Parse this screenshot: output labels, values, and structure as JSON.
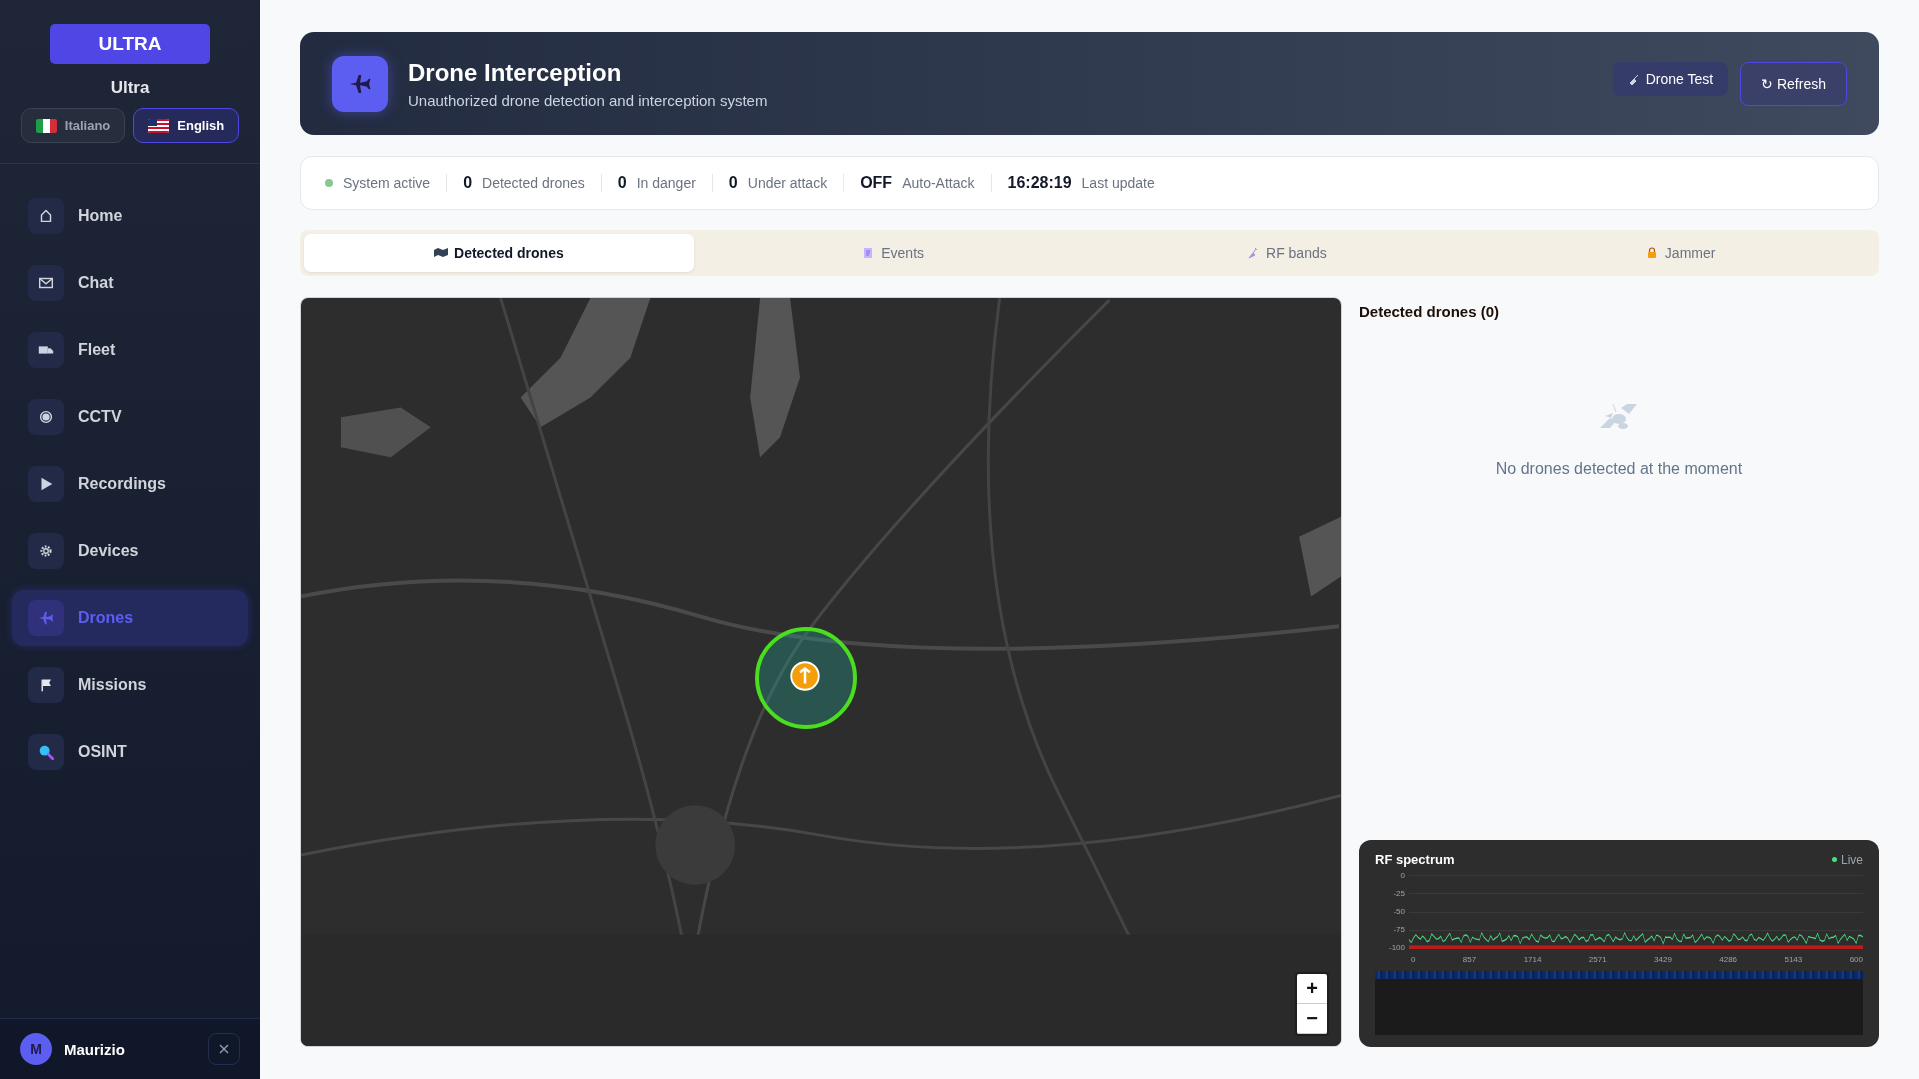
{
  "sidebar": {
    "logo": "ULTRA",
    "brand": "Ultra",
    "languages": [
      {
        "label": "Italiano",
        "selected": false
      },
      {
        "label": "English",
        "selected": true
      }
    ],
    "items": [
      {
        "label": "Home",
        "selected": false
      },
      {
        "label": "Chat",
        "selected": false
      },
      {
        "label": "Fleet",
        "selected": false
      },
      {
        "label": "CCTV",
        "selected": false
      },
      {
        "label": "Recordings",
        "selected": false
      },
      {
        "label": "Devices",
        "selected": false
      },
      {
        "label": "Drones",
        "selected": true
      },
      {
        "label": "Missions",
        "selected": false
      },
      {
        "label": "OSINT",
        "selected": false
      }
    ],
    "user": {
      "initial": "M",
      "name": "Maurizio"
    }
  },
  "header": {
    "title": "Drone Interception",
    "subtitle": "Unauthorized drone detection and interception system",
    "buttons": [
      {
        "label": "Drone Test",
        "kind": "test"
      },
      {
        "label": "↻ Refresh",
        "kind": "refresh"
      }
    ]
  },
  "status": [
    {
      "kind": "indicator",
      "label": "System active",
      "on": true
    },
    {
      "kind": "count",
      "value": "0",
      "label": "Detected drones"
    },
    {
      "kind": "count",
      "value": "0",
      "label": "In danger"
    },
    {
      "kind": "count",
      "value": "0",
      "label": "Under attack"
    },
    {
      "kind": "count",
      "value": "OFF",
      "label": "Auto-Attack"
    },
    {
      "kind": "count",
      "value": "16:28:19",
      "label": "Last update"
    }
  ],
  "tabs": [
    {
      "label": "Detected drones",
      "selected": true
    },
    {
      "label": "Events",
      "selected": false
    },
    {
      "label": "RF bands",
      "selected": false
    },
    {
      "label": "Jammer",
      "selected": false
    }
  ],
  "map": {
    "kind": "picture",
    "zoom_in": "+",
    "zoom_out": "−"
  },
  "drones_panel": {
    "title": "Detected drones (0)",
    "empty_message": "No drones detected at the moment"
  },
  "rf_spectrum": {
    "title": "RF spectrum",
    "live": "Live",
    "y_ticks": [
      "0",
      "-25",
      "-50",
      "-75",
      "-100"
    ],
    "x_ticks": [
      "0",
      "857",
      "1714",
      "2571",
      "3429",
      "4286",
      "5143",
      "600"
    ]
  }
}
